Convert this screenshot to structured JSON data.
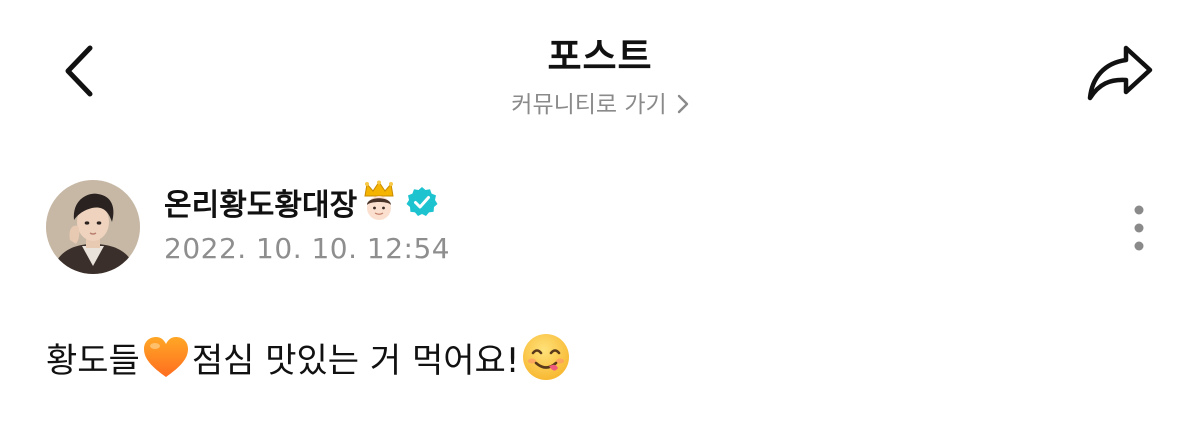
{
  "header": {
    "title": "포스트",
    "community_link": "커뮤니티로 가기",
    "back_icon": "chevron-left-icon",
    "share_icon": "share-arrow-icon"
  },
  "post": {
    "author": "온리황도황대장",
    "author_emoji": "crown-person-emoji",
    "verified_icon": "verified-badge-icon",
    "date": "2022. 10. 10. 12:54",
    "body_part1": "황도들",
    "body_emoji1": "orange-heart-emoji",
    "body_part2": "점심 맛있는 거 먹어요!",
    "body_emoji2": "yum-face-emoji",
    "more_icon": "more-vertical-icon"
  },
  "colors": {
    "verified": "#1EC3D0",
    "muted_text": "#8E8E8E",
    "primary_text": "#111111"
  }
}
